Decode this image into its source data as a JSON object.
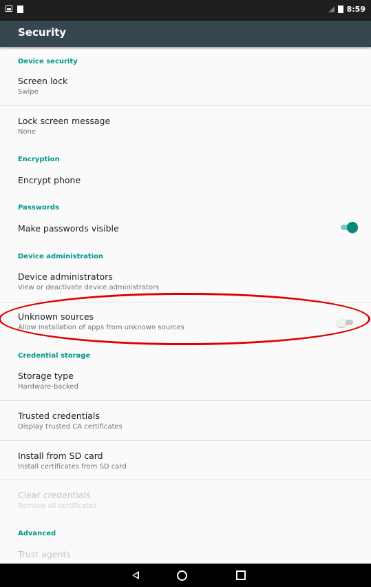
{
  "status_bar": {
    "time": "8:59"
  },
  "app_bar": {
    "title": "Security"
  },
  "categories": {
    "device_security": "Device security",
    "encryption": "Encryption",
    "passwords": "Passwords",
    "device_administration": "Device administration",
    "credential_storage": "Credential storage",
    "advanced": "Advanced"
  },
  "prefs": {
    "screen_lock": {
      "title": "Screen lock",
      "summary": "Swipe"
    },
    "lock_screen_message": {
      "title": "Lock screen message",
      "summary": "None"
    },
    "encrypt_phone": {
      "title": "Encrypt phone"
    },
    "make_passwords_visible": {
      "title": "Make passwords visible",
      "enabled": true
    },
    "device_administrators": {
      "title": "Device administrators",
      "summary": "View or deactivate device administrators"
    },
    "unknown_sources": {
      "title": "Unknown sources",
      "summary": "Allow installation of apps from unknown sources",
      "enabled": false
    },
    "storage_type": {
      "title": "Storage type",
      "summary": "Hardware-backed"
    },
    "trusted_credentials": {
      "title": "Trusted credentials",
      "summary": "Display trusted CA certificates"
    },
    "install_from_sd": {
      "title": "Install from SD card",
      "summary": "Install certificates from SD card"
    },
    "clear_credentials": {
      "title": "Clear credentials",
      "summary": "Remove all certificates"
    },
    "trust_agents": {
      "title": "Trust agents"
    }
  },
  "colors": {
    "accent": "#009688",
    "app_bar": "#37474f",
    "highlight": "#e00000"
  },
  "icons": {
    "status_left": [
      "image-icon",
      "document-icon"
    ],
    "status_right": [
      "signal-icon",
      "battery-icon"
    ],
    "navigation": [
      "back-icon",
      "home-icon",
      "recent-apps-icon"
    ]
  }
}
